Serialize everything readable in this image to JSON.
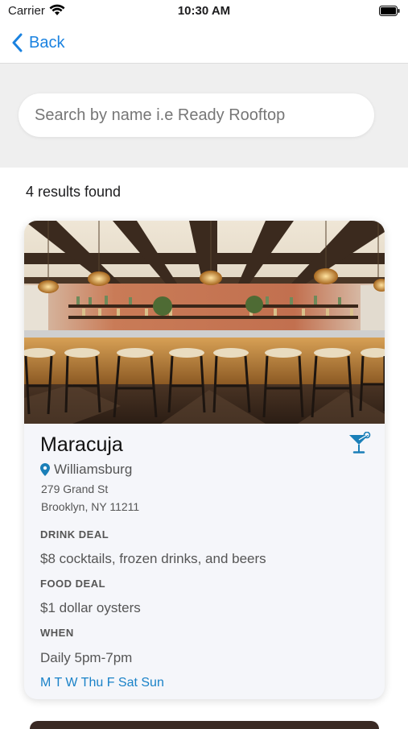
{
  "status_bar": {
    "carrier": "Carrier",
    "time": "10:30 AM"
  },
  "nav": {
    "back_label": "Back"
  },
  "search": {
    "placeholder": "Search by name i.e Ready Rooftop",
    "value": ""
  },
  "results": {
    "count_text": "4 results found"
  },
  "venues": [
    {
      "name": "Maracuja",
      "neighborhood": "Williamsburg",
      "address_line1": "279 Grand St",
      "address_line2": "Brooklyn, NY 11211",
      "drink_deal_label": "DRINK DEAL",
      "drink_deal": "$8 cocktails, frozen drinks, and beers",
      "food_deal_label": "FOOD DEAL",
      "food_deal": "$1 dollar oysters",
      "when_label": "WHEN",
      "when": "Daily 5pm-7pm",
      "days": "M T W Thu F Sat Sun",
      "icon": "cocktail-icon"
    }
  ],
  "colors": {
    "accent": "#1a82e0",
    "days": "#1a82c8",
    "pin": "#1a7fb8"
  }
}
